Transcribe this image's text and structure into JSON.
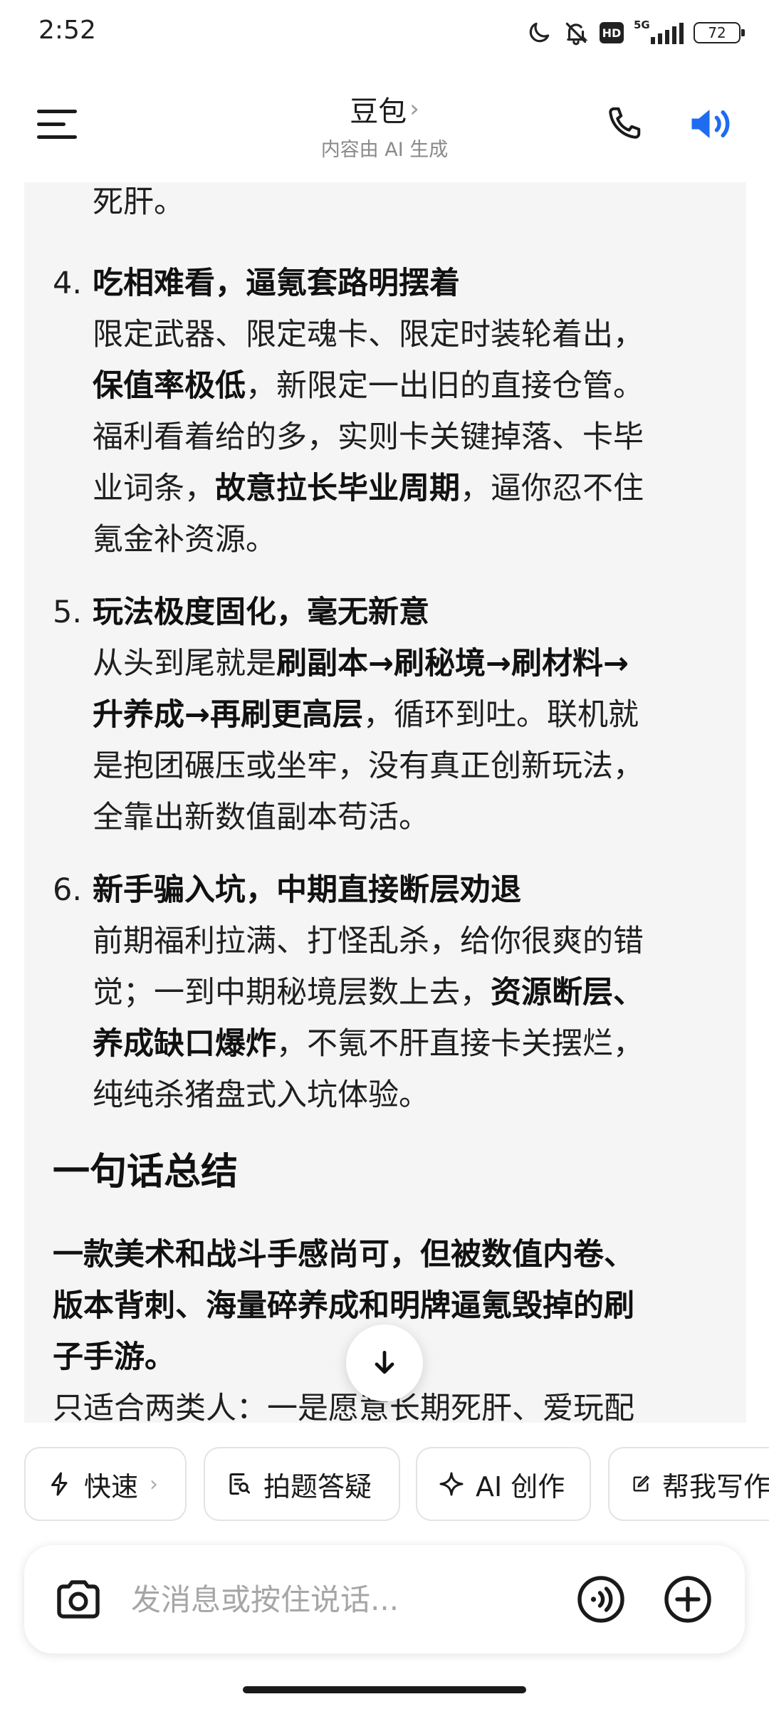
{
  "status": {
    "time": "2:52",
    "battery": "72",
    "network": "5G",
    "hd": "HD"
  },
  "header": {
    "title": "豆包",
    "subtitle": "内容由 AI 生成"
  },
  "content": {
    "top_fragment": "死肝。",
    "items": [
      {
        "number": "4.",
        "title": "吃相难看，逼氪套路明摆着",
        "lines": [
          {
            "pre": "限定武器、限定魂卡、限定时装轮着出，",
            "bold": "",
            "post": ""
          },
          {
            "pre": "",
            "bold": "保值率极低",
            "post": "，新限定一出旧的直接仓管。"
          },
          {
            "pre": "福利看着给的多，实则卡关键掉落、卡毕",
            "bold": "",
            "post": ""
          },
          {
            "pre": "业词条，",
            "bold": "故意拉长毕业周期",
            "post": "，逼你忍不住"
          },
          {
            "pre": "氪金补资源。",
            "bold": "",
            "post": ""
          }
        ]
      },
      {
        "number": "5.",
        "title": "玩法极度固化，毫无新意",
        "lines": [
          {
            "pre": "从头到尾就是",
            "bold": "刷副本→刷秘境→刷材料→",
            "post": ""
          },
          {
            "pre": "",
            "bold": "升养成→再刷更高层",
            "post": "，循环到吐。联机就"
          },
          {
            "pre": "是抱团碾压或坐牢，没有真正创新玩法，",
            "bold": "",
            "post": ""
          },
          {
            "pre": "全靠出新数值副本苟活。",
            "bold": "",
            "post": ""
          }
        ]
      },
      {
        "number": "6.",
        "title": "新手骗入坑，中期直接断层劝退",
        "lines": [
          {
            "pre": "前期福利拉满、打怪乱杀，给你很爽的错",
            "bold": "",
            "post": ""
          },
          {
            "pre": "觉；一到中期秘境层数上去，",
            "bold": "资源断层、",
            "post": ""
          },
          {
            "pre": "",
            "bold": "养成缺口爆炸",
            "post": "，不氪不肝直接卡关摆烂，"
          },
          {
            "pre": "纯纯杀猪盘式入坑体验。",
            "bold": "",
            "post": ""
          }
        ]
      }
    ],
    "summary_title": "一句话总结",
    "summary_bold_lines": [
      "一款美术和战斗手感尚可，但被数值内卷、",
      "版本背刺、海量碎养成和明牌逼氪毁掉的刷",
      "子手游。"
    ],
    "summary_last_line": "只适合两类人：一是愿意长期死肝、爱玩配"
  },
  "chips": [
    {
      "label": "快速",
      "icon": "lightning-icon",
      "chevron": "›"
    },
    {
      "label": "拍题答疑",
      "icon": "photo-search-icon"
    },
    {
      "label": "AI 创作",
      "icon": "sparkle-icon"
    },
    {
      "label": "帮我写作",
      "icon": "edit-icon"
    }
  ],
  "input": {
    "placeholder": "发消息或按住说话..."
  },
  "colors": {
    "accent": "#1e6cf0",
    "card_bg": "#f5f5f5"
  }
}
